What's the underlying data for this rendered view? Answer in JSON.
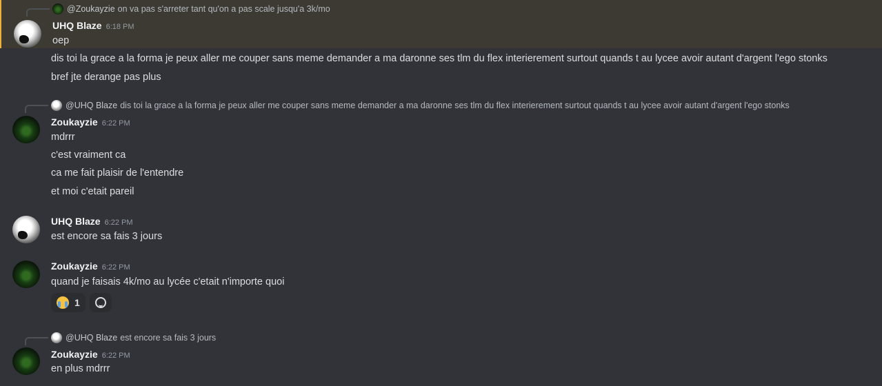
{
  "messages": [
    {
      "reply": {
        "author": "@Zoukayzie",
        "text": "on va pas s'arreter tant qu'on a pas scale jusqu'a 3k/mo"
      },
      "author": "UHQ Blaze",
      "time": "6:18 PM",
      "lines": [
        "oep",
        "dis toi la grace a la forma je peux aller me couper sans meme demander a ma daronne ses tlm du flex interierement surtout quands t au lycee avoir autant d'argent l'ego stonks",
        "bref jte derange pas plus"
      ]
    },
    {
      "reply": {
        "author": "@UHQ Blaze",
        "text": "dis toi la grace a la forma je peux aller me couper sans meme demander a ma daronne ses tlm du flex interierement surtout quands t au lycee avoir autant d'argent l'ego stonks"
      },
      "author": "Zoukayzie",
      "time": "6:22 PM",
      "lines": [
        "mdrrr",
        "c'est vraiment ca",
        "ca me fait plaisir de l'entendre",
        "et moi c'etait pareil"
      ]
    },
    {
      "author": "UHQ Blaze",
      "time": "6:22 PM",
      "lines": [
        "est encore sa fais 3 jours"
      ]
    },
    {
      "author": "Zoukayzie",
      "time": "6:22 PM",
      "lines": [
        "quand je faisais 4k/mo au lycée c'etait n'importe quoi"
      ],
      "reactions": [
        {
          "emoji": "loudly-crying-face-icon",
          "count": "1"
        }
      ]
    },
    {
      "reply": {
        "author": "@UHQ Blaze",
        "text": "est encore sa fais 3 jours"
      },
      "author": "Zoukayzie",
      "time": "6:22 PM",
      "lines": [
        "en plus mdrrr"
      ]
    }
  ],
  "colors": {
    "background": "#313338",
    "highlight": "#3c3a32",
    "highlight_border": "#f0b232",
    "text": "#dbdee1",
    "username": "#f2f3f5",
    "timestamp": "#949ba4"
  }
}
